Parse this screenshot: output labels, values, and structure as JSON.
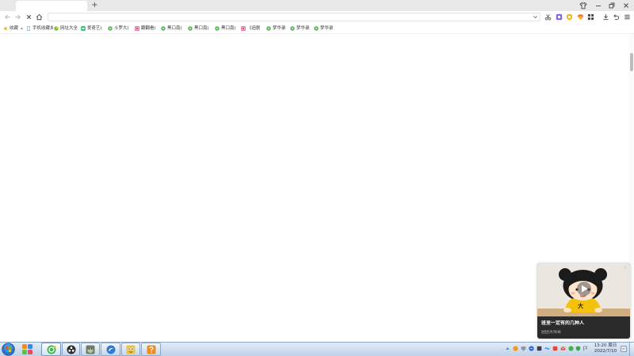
{
  "window": {
    "tabs": [
      {
        "title": ""
      }
    ],
    "new_tab_label": "+",
    "controls": [
      "skin-icon",
      "minimize-icon",
      "restore-icon",
      "close-icon"
    ]
  },
  "toolbar": {
    "address": {
      "value": ""
    },
    "nav_icons": [
      "back-icon",
      "forward-icon",
      "stop-icon",
      "home-icon"
    ],
    "right_icons": [
      "chevron-down-icon",
      "scissors-icon",
      "purple-app-icon",
      "orange-badge-icon",
      "gem-icon",
      "apps-grid-icon",
      "download-icon",
      "undo-icon",
      "menu-icon"
    ]
  },
  "bookmarks": [
    {
      "label": "收藏",
      "icon": "star-icon"
    },
    {
      "label": "手机收藏夹",
      "icon": "phone-icon"
    },
    {
      "label": "网址大全",
      "icon": "site-nav-icon"
    },
    {
      "label": "爱奇艺(",
      "icon": "iqiyi-icon"
    },
    {
      "label": "斗罗大(",
      "icon": "video-play-icon"
    },
    {
      "label": "翻翻看(",
      "icon": "pink-page-icon"
    },
    {
      "label": "黑口南(",
      "icon": "video-play-icon"
    },
    {
      "label": "黑口南(",
      "icon": "video-play-icon"
    },
    {
      "label": "黑口南(",
      "icon": "video-play-icon"
    },
    {
      "label": "《追剧",
      "icon": "pink-page-icon"
    },
    {
      "label": "梦华录",
      "icon": "video-play-icon"
    },
    {
      "label": "梦华录",
      "icon": "video-play-icon"
    },
    {
      "label": "梦华录",
      "icon": "video-play-icon"
    }
  ],
  "video_card": {
    "title": "班里一定有的几种人",
    "author": "团团大师哥",
    "thumbnail_text": "大"
  },
  "taskbar": {
    "start_icon": "windows-start-icon",
    "apps": [
      "colorful-app-icon",
      "browser-360-icon",
      "obs-icon",
      "game-icon",
      "blue-app-icon",
      "yellow-app-icon",
      "help-icon"
    ],
    "tray_icons": [
      "tray-expand-icon",
      "tray-orange-icon",
      "tray-monitor-icon",
      "tray-blue-icon",
      "tray-dark-icon",
      "tray-wave-icon",
      "tray-red-icon",
      "tray-red-box-icon",
      "tray-green-icon",
      "tray-shield-icon",
      "tray-flag-icon"
    ],
    "clock": {
      "time": "13:20 周日",
      "date": "2022/7/10"
    }
  },
  "colors": {
    "tabstrip": "#e8e8e8",
    "taskbar": "#c3d6ea",
    "card_text_bg": "#2b2b2b",
    "bookmark_play": "#5cb85c",
    "bookmark_pink": "#e2457b",
    "shirt": "#f4c20d"
  }
}
